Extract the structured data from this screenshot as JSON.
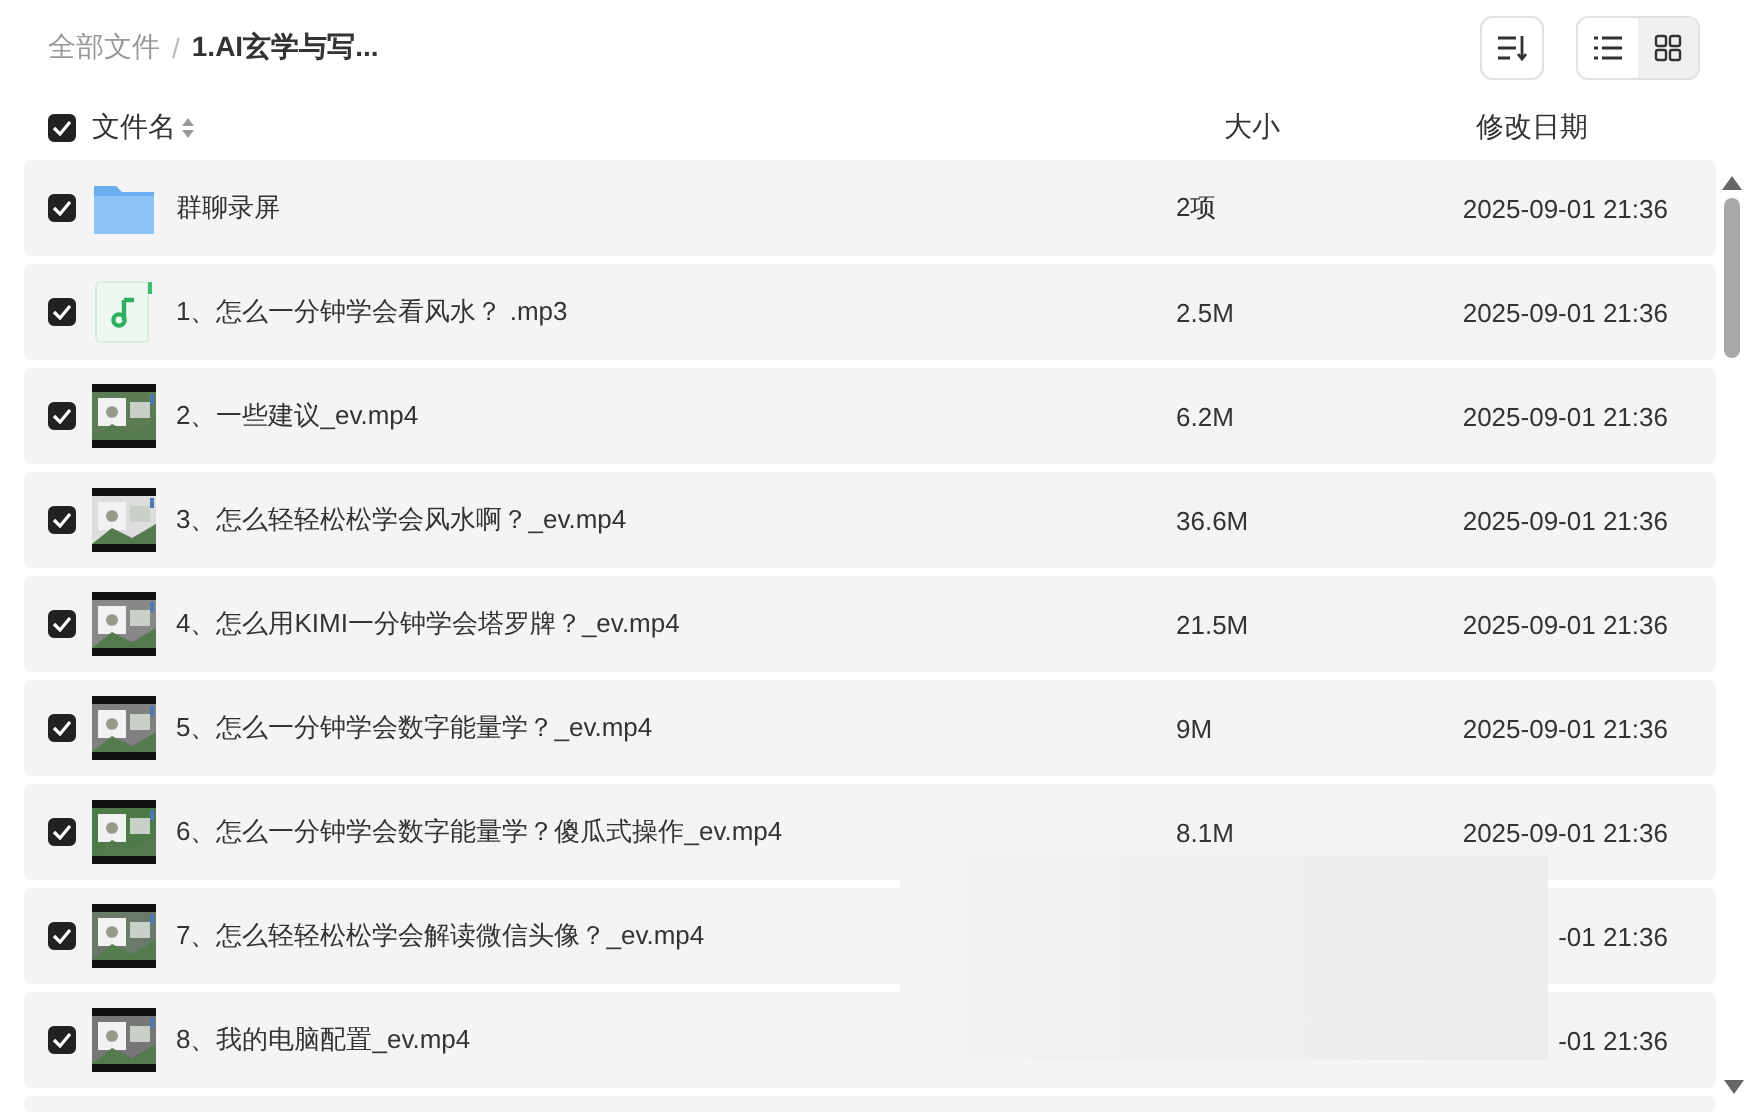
{
  "breadcrumb_separator": "/",
  "breadcrumb": [
    {
      "label": "全部文件",
      "current": false
    },
    {
      "label": "1.AI玄学与写...",
      "current": true
    }
  ],
  "view_modes": [
    {
      "kind": "list",
      "selected": false
    },
    {
      "kind": "grid",
      "selected": true
    }
  ],
  "header": {
    "select_all_checked": true,
    "name": "文件名",
    "size": "大小",
    "date": "修改日期"
  },
  "rows": [
    {
      "kind": "folder",
      "checked": true,
      "name": "群聊录屏",
      "size": "2项",
      "date": "2025-09-01 21:36"
    },
    {
      "kind": "audio",
      "checked": true,
      "name": "1、怎么一分钟学会看风水？ .mp3",
      "size": "2.5M",
      "date": "2025-09-01 21:36"
    },
    {
      "kind": "video",
      "checked": true,
      "name": "2、一些建议_ev.mp4",
      "size": "6.2M",
      "date": "2025-09-01 21:36"
    },
    {
      "kind": "video",
      "checked": true,
      "name": "3、怎么轻轻松松学会风水啊？_ev.mp4",
      "size": "36.6M",
      "date": "2025-09-01 21:36"
    },
    {
      "kind": "video",
      "checked": true,
      "name": "4、怎么用KIMI一分钟学会塔罗牌？_ev.mp4",
      "size": "21.5M",
      "date": "2025-09-01 21:36"
    },
    {
      "kind": "video",
      "checked": true,
      "name": "5、怎么一分钟学会数字能量学？_ev.mp4",
      "size": "9M",
      "date": "2025-09-01 21:36"
    },
    {
      "kind": "video",
      "checked": true,
      "name": "6、怎么一分钟学会数字能量学？傻瓜式操作_ev.mp4",
      "size": "8.1M",
      "date": "2025-09-01 21:36"
    },
    {
      "kind": "video",
      "checked": true,
      "name": "7、怎么轻轻松松学会解读微信头像？_ev.mp4",
      "date": "-01 21:36"
    },
    {
      "kind": "video",
      "checked": true,
      "name": "8、我的电脑配置_ev.mp4",
      "date": "-01 21:36"
    }
  ]
}
